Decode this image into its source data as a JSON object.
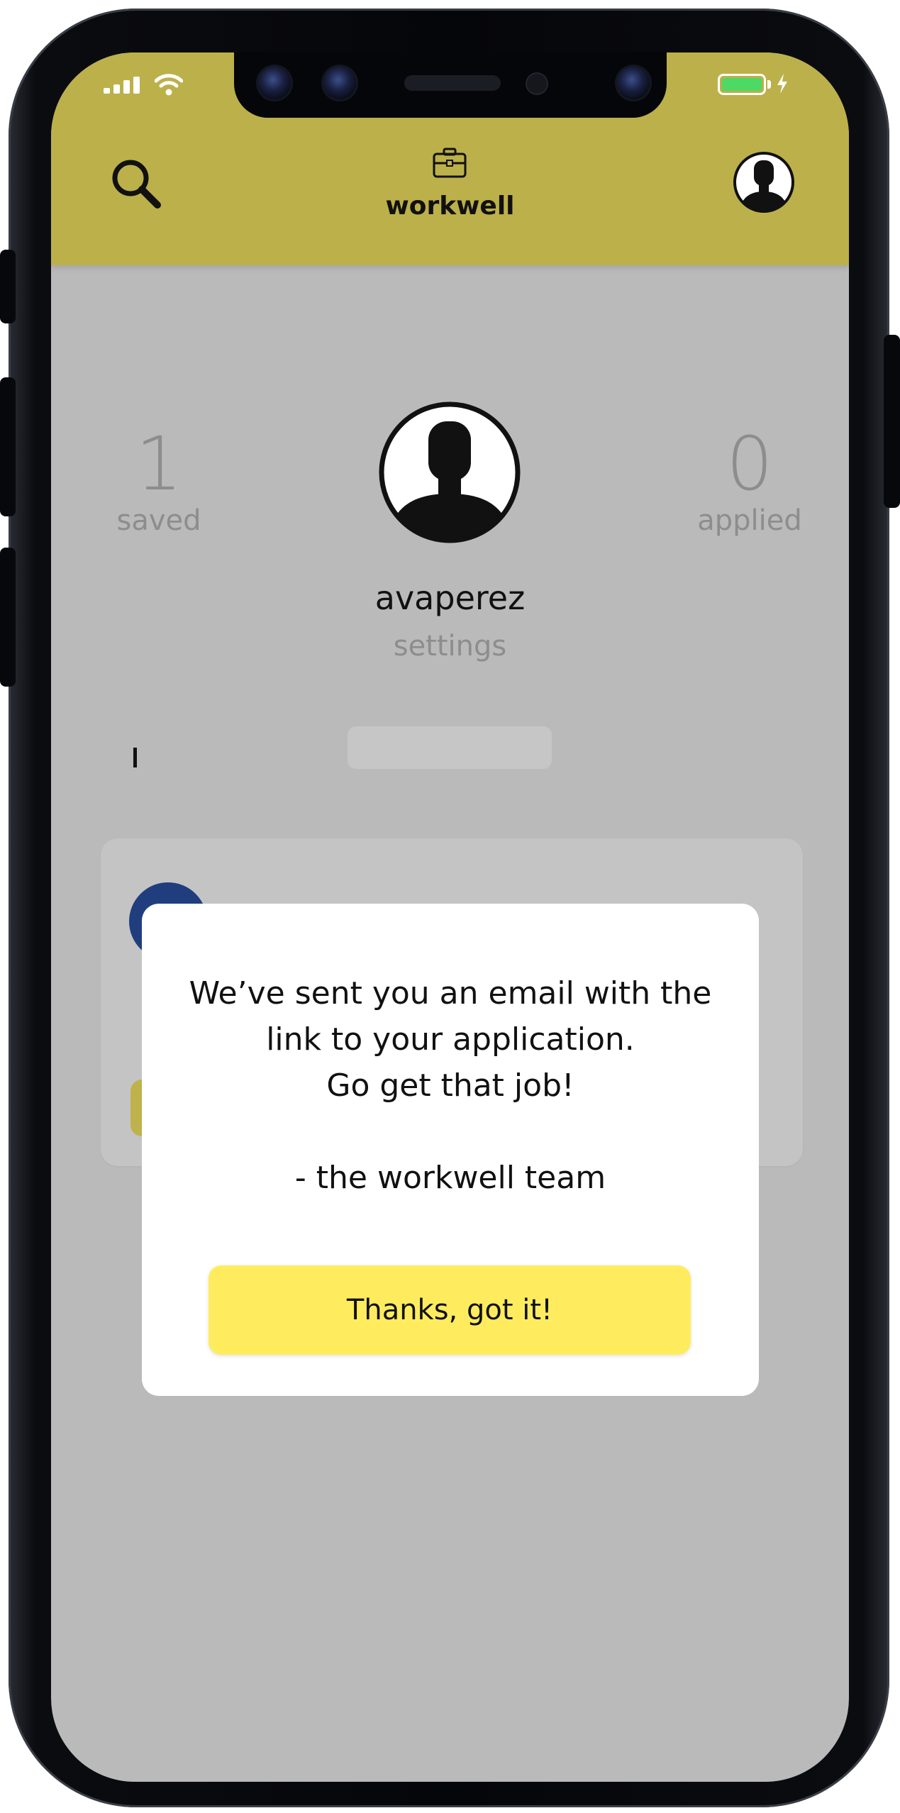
{
  "colors": {
    "header_bg": "#bcb04a",
    "overlay_bg": "#bababa",
    "button_bg": "#ffec5e",
    "battery": "#4cd964"
  },
  "icons": {
    "search": "search-icon",
    "brand": "briefcase-icon",
    "account": "user-avatar-icon"
  },
  "header": {
    "brand": "workwell"
  },
  "profile": {
    "saved_count": "1",
    "saved_label": "saved",
    "applied_count": "0",
    "applied_label": "applied",
    "username": "avaperez",
    "settings_label": "settings"
  },
  "modal": {
    "line1": "We’ve sent you an email with the",
    "line2": "link to your application.",
    "line3": "Go get that job!",
    "signature": "- the workwell team",
    "button_label": "Thanks, got it!"
  }
}
